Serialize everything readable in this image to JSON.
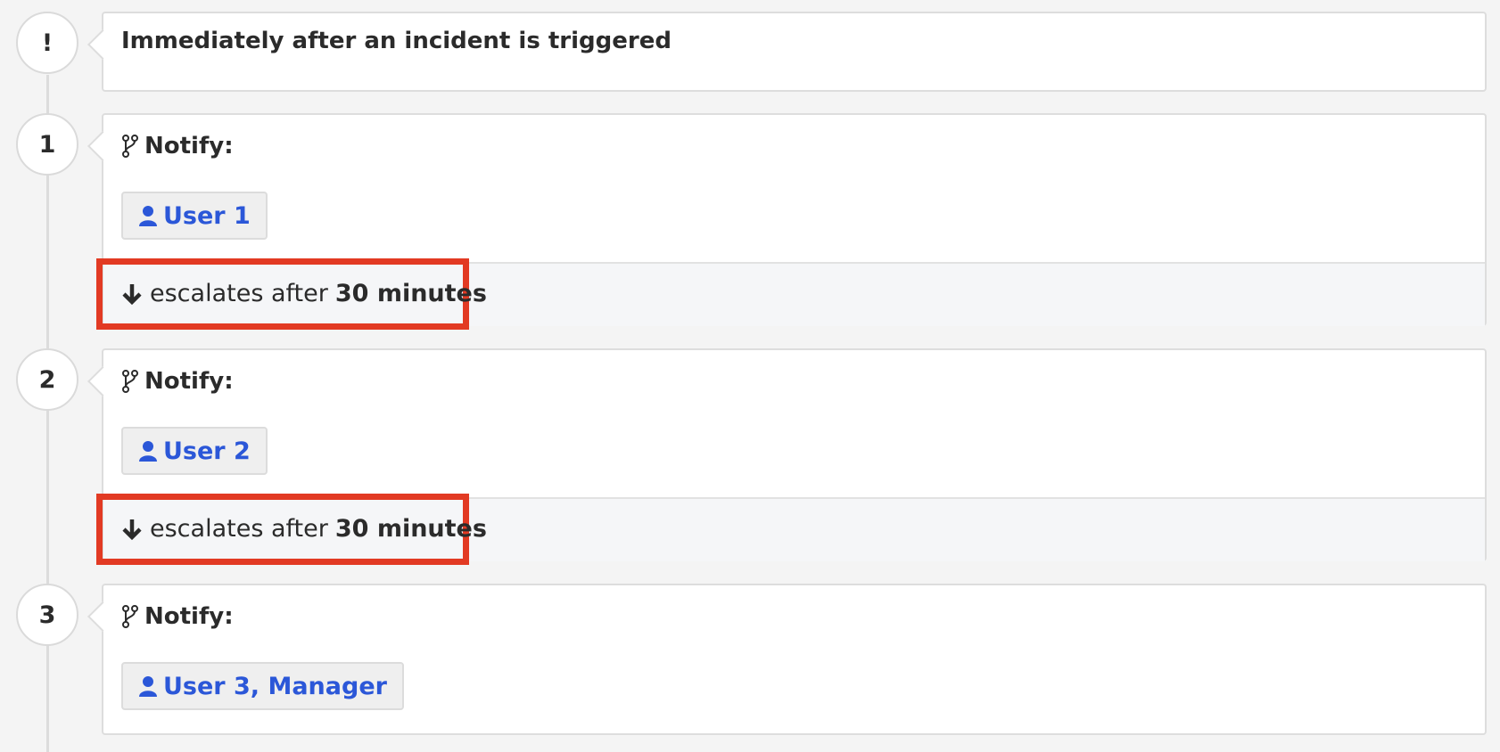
{
  "trigger": {
    "marker": "!",
    "label": "Immediately after an incident is triggered"
  },
  "steps": [
    {
      "number": "1",
      "notify_label": "Notify:",
      "target": "User 1",
      "escalation": {
        "prefix": "escalates after",
        "delay": "30 minutes"
      }
    },
    {
      "number": "2",
      "notify_label": "Notify:",
      "target": "User 2",
      "escalation": {
        "prefix": "escalates after",
        "delay": "30 minutes"
      }
    },
    {
      "number": "3",
      "notify_label": "Notify:",
      "target": "User 3, Manager"
    }
  ],
  "icons": {
    "notify": "branch-icon",
    "target": "user-icon",
    "escalation": "arrow-down-icon"
  },
  "colors": {
    "link": "#2b57d8",
    "highlight": "#e23a23"
  }
}
